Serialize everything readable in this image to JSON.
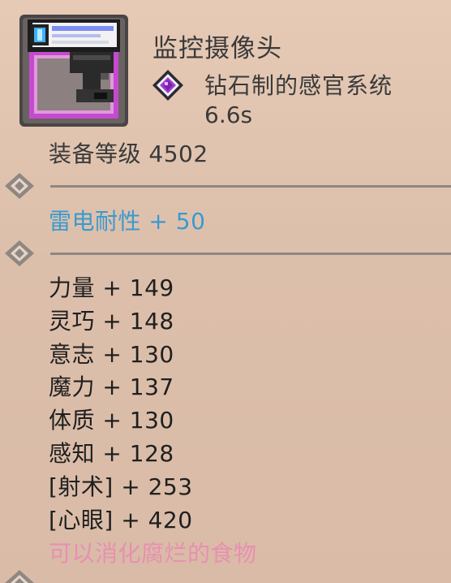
{
  "item": {
    "name": "监控摄像头",
    "icon": "security-camera-icon",
    "type_icon": "diamond-gem-icon",
    "type": "钻石制的感官系统",
    "time": "6.6s",
    "equip_level": "装备等级 4502"
  },
  "resist": "雷电耐性 + 50",
  "stats": [
    "力量 + 149",
    "灵巧 + 148",
    "意志 + 130",
    "魔力 + 137",
    "体质 + 130",
    "感知 + 128",
    "[射术] + 253",
    "[心眼] + 420"
  ],
  "special": "可以消化腐烂的食物",
  "colors": {
    "background": "#e0c4b0",
    "text": "#3a3a3a",
    "resist": "#3a9ad0",
    "special": "#e98fb2",
    "divider": "#8f8781",
    "gem": "#a040d0"
  }
}
